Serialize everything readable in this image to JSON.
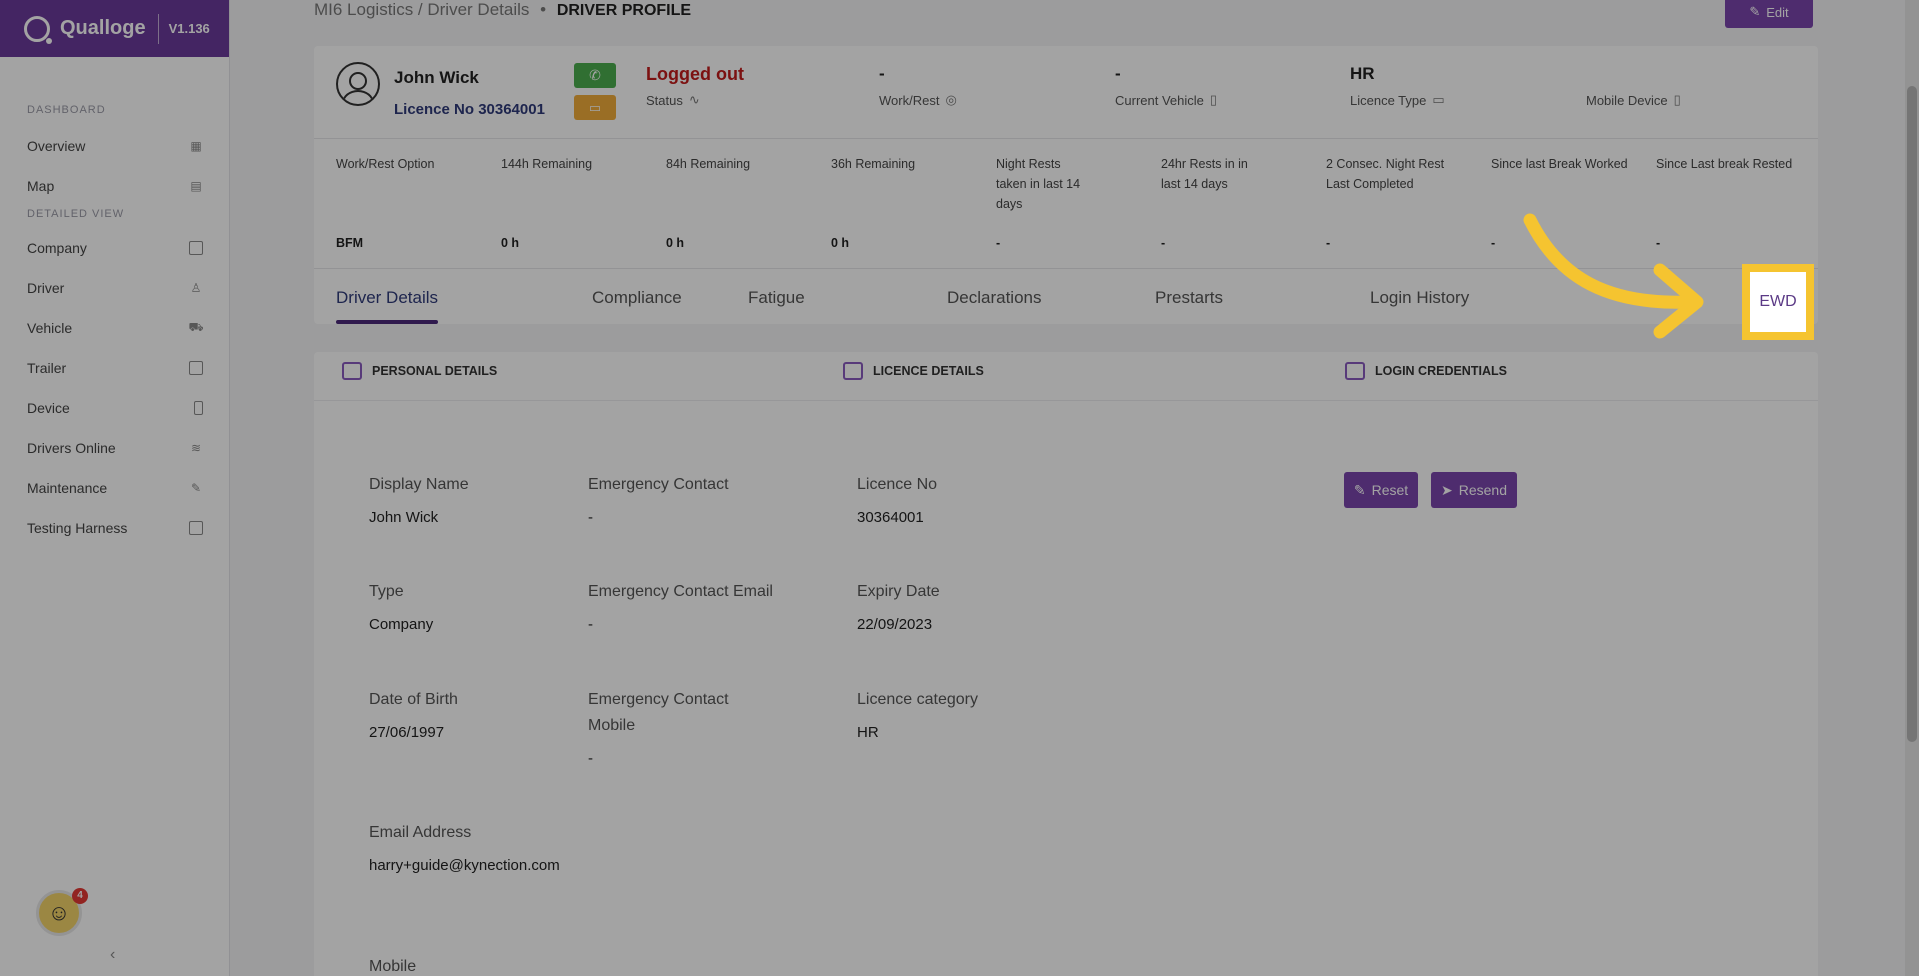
{
  "app": {
    "brand_name": "Qualloge",
    "version": "V1.136"
  },
  "sidebar": {
    "dashboard_label": "DASHBOARD",
    "detailed_label": "DETAILED VIEW",
    "items": [
      {
        "label": "Overview",
        "icon": "grid-icon"
      },
      {
        "label": "Map",
        "icon": "map-icon"
      },
      {
        "label": "Company",
        "icon": "building-icon"
      },
      {
        "label": "Driver",
        "icon": "user-icon"
      },
      {
        "label": "Vehicle",
        "icon": "truck-icon"
      },
      {
        "label": "Trailer",
        "icon": "trailer-icon"
      },
      {
        "label": "Device",
        "icon": "phone-icon"
      },
      {
        "label": "Drivers Online",
        "icon": "wifi-icon"
      },
      {
        "label": "Maintenance",
        "icon": "wrench-icon"
      },
      {
        "label": "Testing Harness",
        "icon": "monitor-icon"
      }
    ],
    "avatar_badge": "4",
    "collapse": "‹"
  },
  "header": {
    "breadcrumb_parent": "MI6 Logistics / Driver Details",
    "breadcrumb_sep": "•",
    "breadcrumb_current": "DRIVER PROFILE",
    "edit_label": "Edit"
  },
  "driver": {
    "name": "John Wick",
    "licence": "Licence No 30364001",
    "status_value": "Logged out",
    "status_label": "Status",
    "workrest_value": "-",
    "workrest_label": "Work/Rest",
    "vehicle_value": "-",
    "vehicle_label": "Current Vehicle",
    "licence_type_value": "HR",
    "licence_type_label": "Licence Type",
    "mobile_label": "Mobile Device"
  },
  "rest_table": {
    "headers": [
      "Work/Rest Option",
      "144h Remaining",
      "84h Remaining",
      "36h Remaining",
      "Night Rests taken in last 14 days",
      "24hr Rests in in last 14 days",
      "2 Consec. Night Rest Last Completed",
      "Since last Break Worked",
      "Since Last break Rested"
    ],
    "values": [
      "BFM",
      "0 h",
      "0 h",
      "0 h",
      "-",
      "-",
      "-",
      "-",
      "-"
    ]
  },
  "tabs": [
    "Driver Details",
    "Compliance",
    "Fatigue",
    "Declarations",
    "Prestarts",
    "Login History",
    "EWD"
  ],
  "sections": {
    "personal": "PERSONAL DETAILS",
    "licence": "LICENCE DETAILS",
    "login": "LOGIN CREDENTIALS"
  },
  "fields": {
    "display_name_label": "Display Name",
    "display_name": "John Wick",
    "emergency_contact_label": "Emergency Contact",
    "emergency_contact": "-",
    "licence_no_label": "Licence No",
    "licence_no": "30364001",
    "type_label": "Type",
    "type": "Company",
    "emergency_email_label": "Emergency Contact Email",
    "emergency_email": "-",
    "expiry_label": "Expiry Date",
    "expiry": "22/09/2023",
    "dob_label": "Date of Birth",
    "dob": "27/06/1997",
    "emergency_mobile_label": "Emergency Contact Mobile",
    "emergency_mobile": "-",
    "licence_category_label": "Licence category",
    "licence_category": "HR",
    "email_label": "Email Address",
    "email": "harry+guide@kynection.com",
    "mobile_label": "Mobile"
  },
  "buttons": {
    "reset": "Reset",
    "resend": "Resend"
  },
  "colors": {
    "brand": "#6b3a9b",
    "highlight": "#f5c430",
    "status_red": "#c21c1c"
  }
}
